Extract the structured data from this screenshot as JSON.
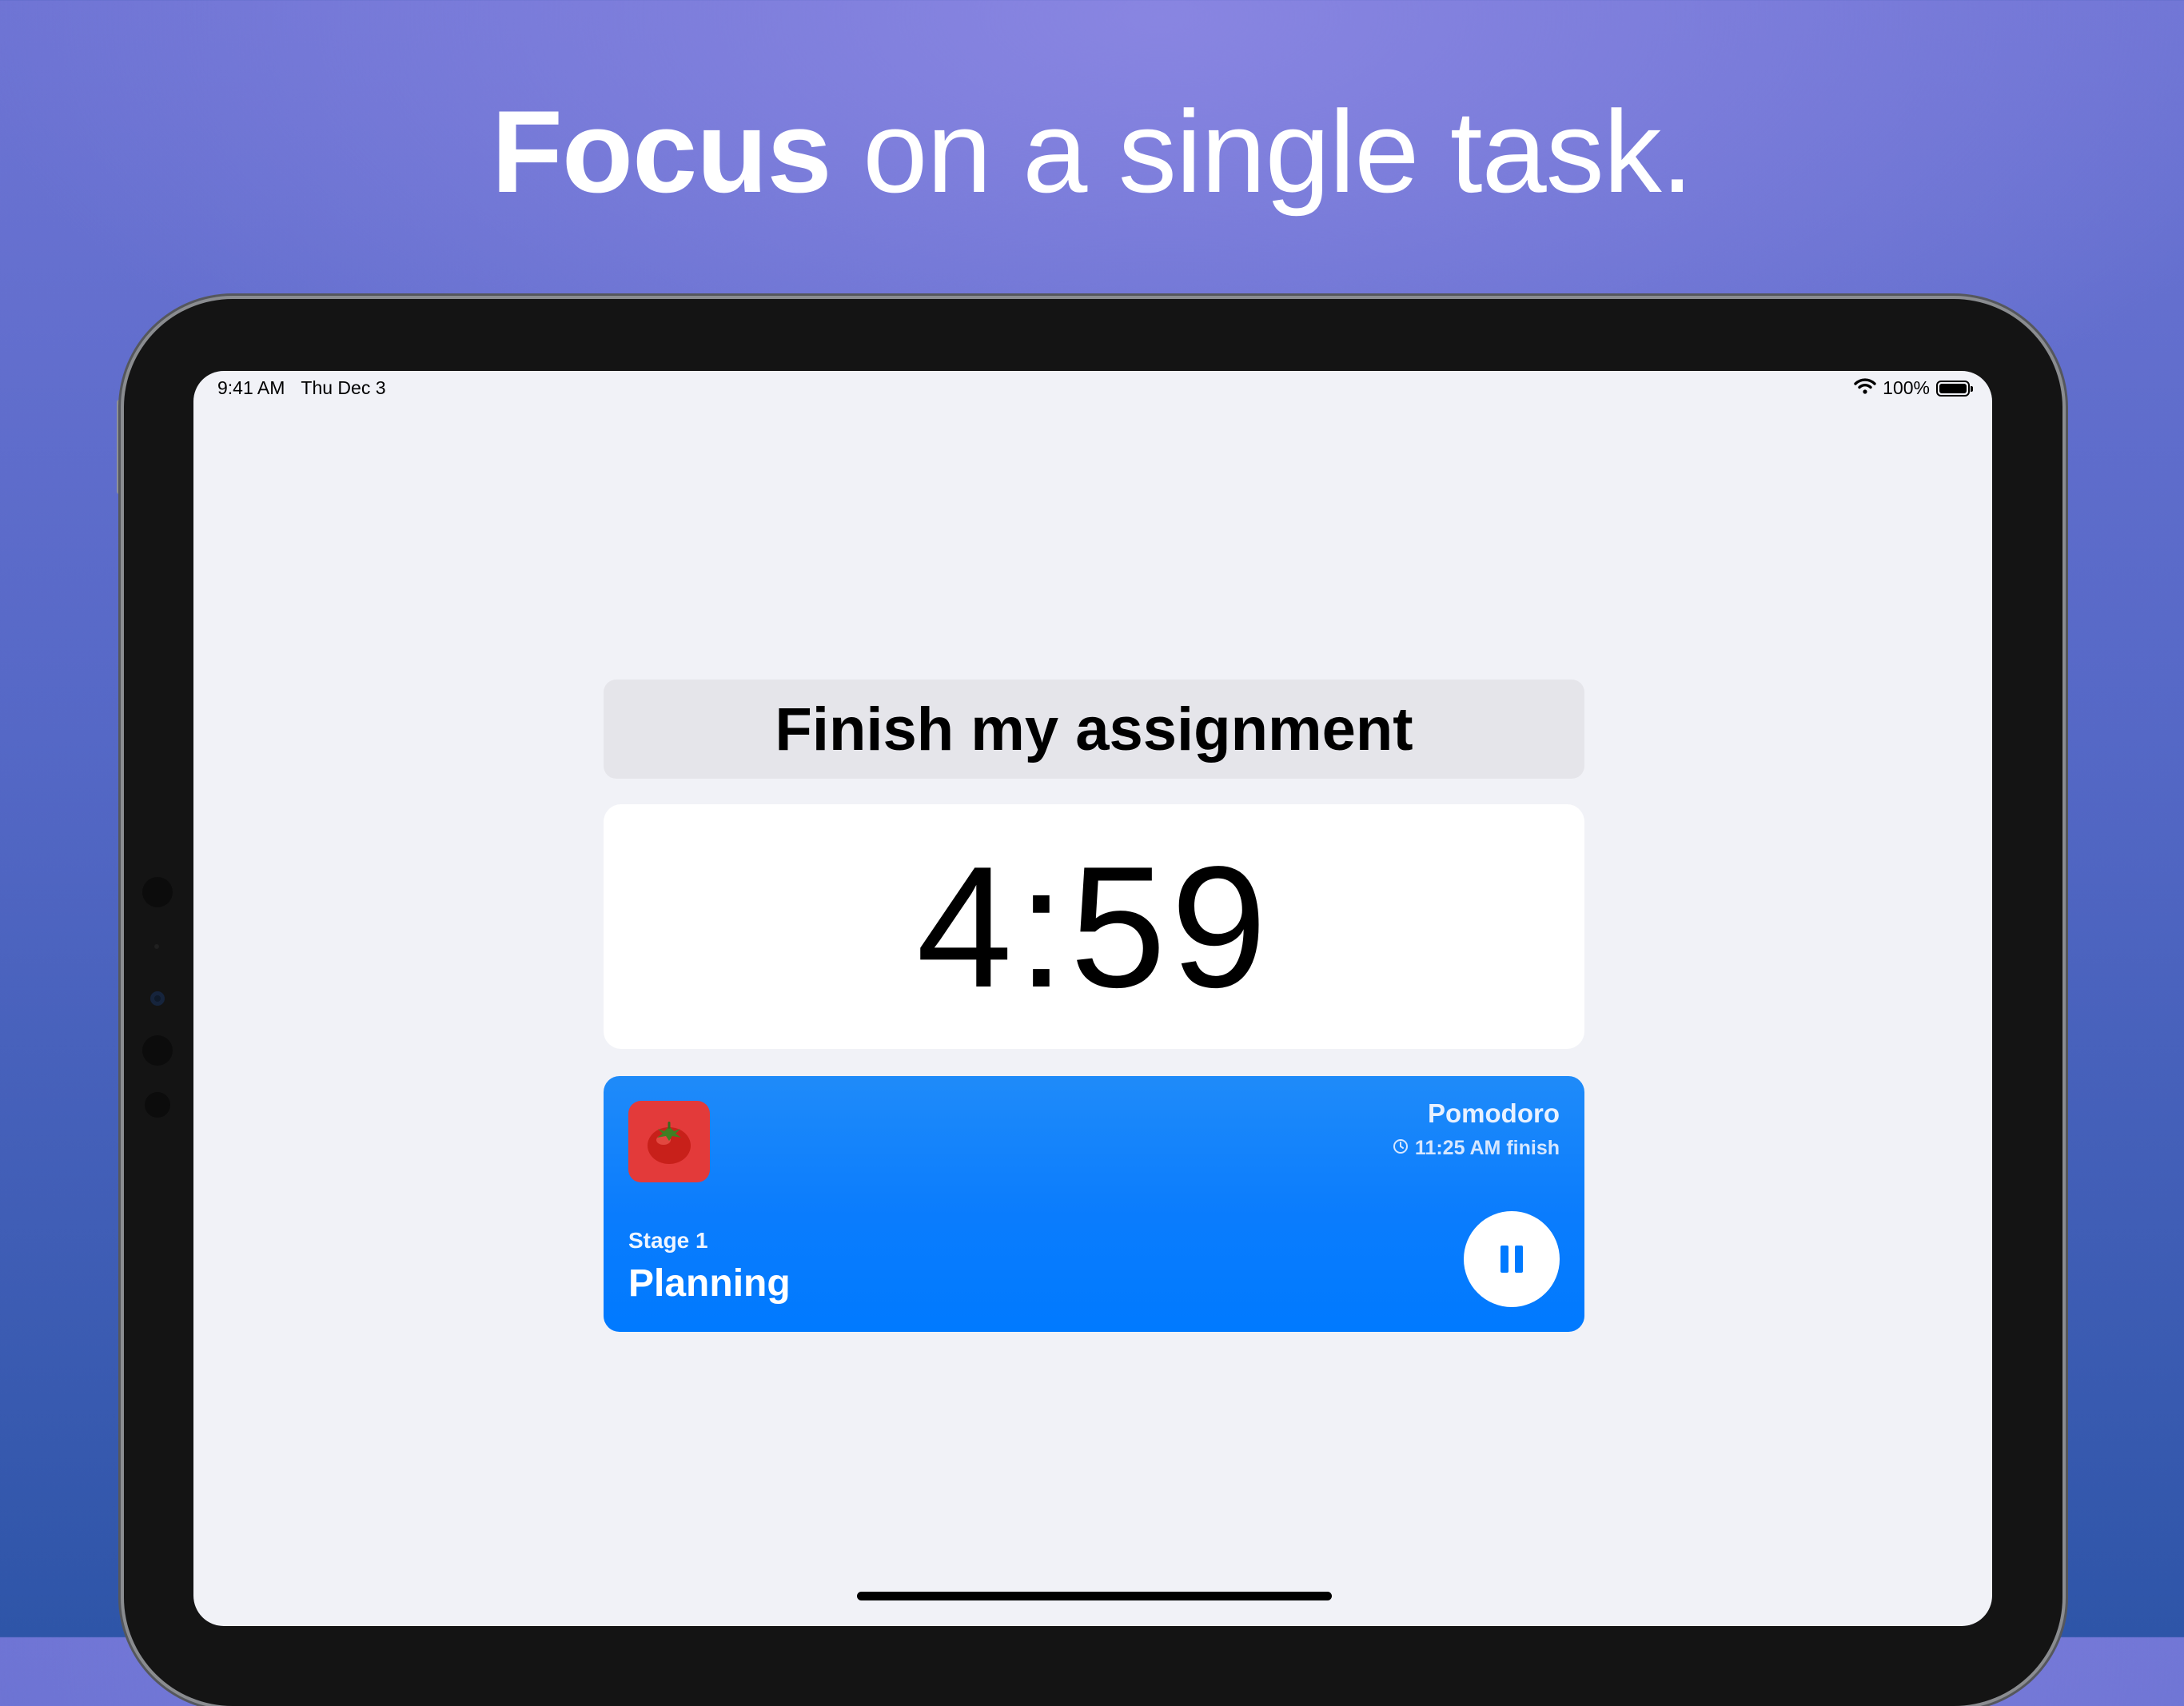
{
  "headline": {
    "bold": "Focus",
    "rest": " on a single task."
  },
  "status_bar": {
    "time": "9:41 AM",
    "date": "Thu Dec 3",
    "battery_percent": "100%",
    "battery_level": 1.0
  },
  "task": {
    "title": "Finish my assignment"
  },
  "timer": {
    "remaining": "4:59"
  },
  "session": {
    "name": "Pomodoro",
    "finish_time": "11:25 AM finish",
    "stage": "Stage 1",
    "phase": "Planning",
    "app_icon": "tomato-icon",
    "control_icon": "pause-icon"
  },
  "colors": {
    "accent": "#007aff",
    "icon_background": "#e33a3a"
  }
}
